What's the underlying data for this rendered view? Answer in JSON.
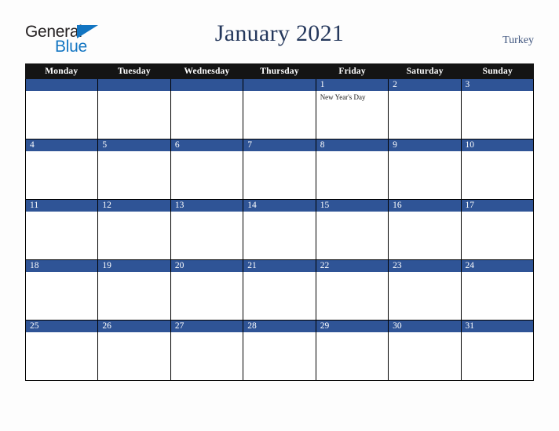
{
  "brand": {
    "name_part1": "General",
    "name_part2": "Blue",
    "triangle_color": "#1275c2",
    "text_color": "#231f20"
  },
  "header": {
    "title": "January 2021",
    "region": "Turkey",
    "title_color": "#25385c",
    "region_color": "#40567f"
  },
  "calendar": {
    "accent_color": "#2f5496",
    "header_bg_color": "#141414",
    "weekdays": [
      "Monday",
      "Tuesday",
      "Wednesday",
      "Thursday",
      "Friday",
      "Saturday",
      "Sunday"
    ],
    "weeks": [
      [
        {
          "day": "",
          "events": []
        },
        {
          "day": "",
          "events": []
        },
        {
          "day": "",
          "events": []
        },
        {
          "day": "",
          "events": []
        },
        {
          "day": "1",
          "events": [
            "New Year's Day"
          ]
        },
        {
          "day": "2",
          "events": []
        },
        {
          "day": "3",
          "events": []
        }
      ],
      [
        {
          "day": "4",
          "events": []
        },
        {
          "day": "5",
          "events": []
        },
        {
          "day": "6",
          "events": []
        },
        {
          "day": "7",
          "events": []
        },
        {
          "day": "8",
          "events": []
        },
        {
          "day": "9",
          "events": []
        },
        {
          "day": "10",
          "events": []
        }
      ],
      [
        {
          "day": "11",
          "events": []
        },
        {
          "day": "12",
          "events": []
        },
        {
          "day": "13",
          "events": []
        },
        {
          "day": "14",
          "events": []
        },
        {
          "day": "15",
          "events": []
        },
        {
          "day": "16",
          "events": []
        },
        {
          "day": "17",
          "events": []
        }
      ],
      [
        {
          "day": "18",
          "events": []
        },
        {
          "day": "19",
          "events": []
        },
        {
          "day": "20",
          "events": []
        },
        {
          "day": "21",
          "events": []
        },
        {
          "day": "22",
          "events": []
        },
        {
          "day": "23",
          "events": []
        },
        {
          "day": "24",
          "events": []
        }
      ],
      [
        {
          "day": "25",
          "events": []
        },
        {
          "day": "26",
          "events": []
        },
        {
          "day": "27",
          "events": []
        },
        {
          "day": "28",
          "events": []
        },
        {
          "day": "29",
          "events": []
        },
        {
          "day": "30",
          "events": []
        },
        {
          "day": "31",
          "events": []
        }
      ]
    ]
  }
}
